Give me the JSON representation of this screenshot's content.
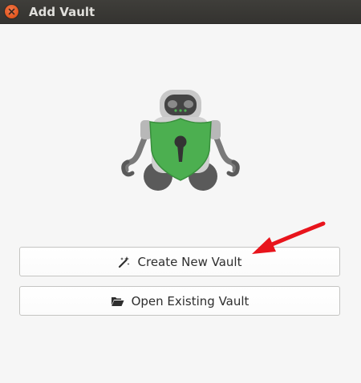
{
  "window": {
    "title": "Add Vault"
  },
  "buttons": {
    "create_label": "Create New Vault",
    "open_label": "Open Existing Vault"
  },
  "icons": {
    "close": "close-icon",
    "logo": "cryptomator-robot-logo",
    "create": "magic-wand-icon",
    "open": "folder-open-icon",
    "annotation": "red-arrow-annotation"
  },
  "colors": {
    "titlebar": "#3c3b37",
    "close_button": "#e2561d",
    "shield_green": "#4caf50",
    "robot_gray": "#7a7a7a",
    "arrow_red": "#e8141c"
  }
}
